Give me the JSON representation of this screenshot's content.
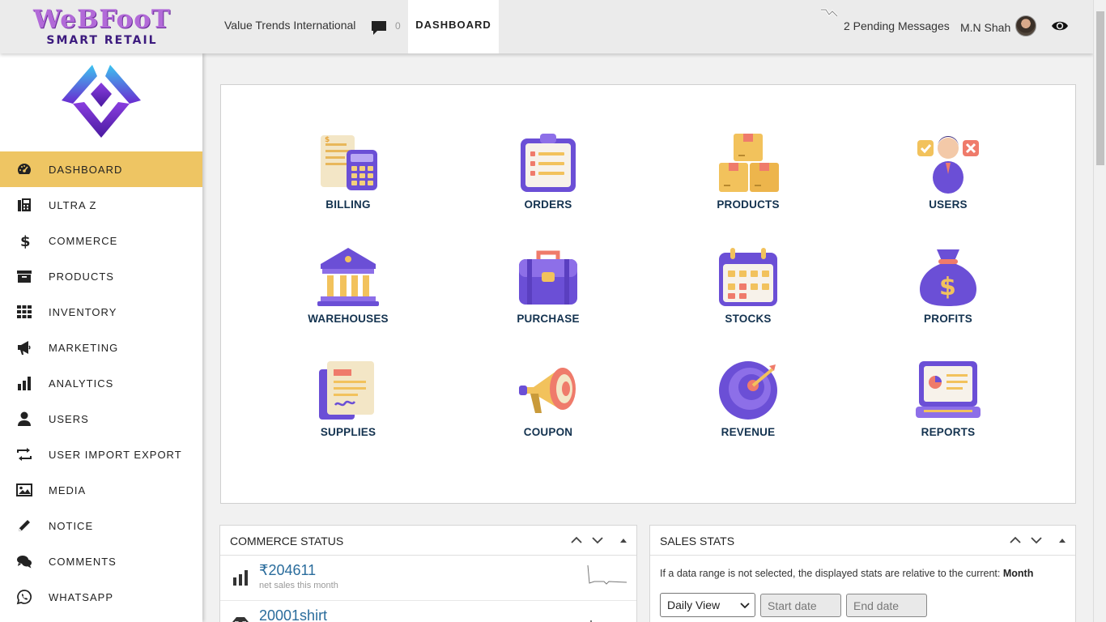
{
  "header": {
    "brand_line1": "WeBFooT",
    "brand_line2": "SMART RETAIL",
    "company": "Value Trends International",
    "message_count": "0",
    "active_tab": "DASHBOARD",
    "pending_messages": "2 Pending Messages",
    "user_name": "M.N Shah"
  },
  "sidebar": {
    "items": [
      {
        "label": "DASHBOARD",
        "icon": "dashboard-gauge-icon",
        "active": true
      },
      {
        "label": "ULTRA Z",
        "icon": "fax-icon"
      },
      {
        "label": "COMMERCE",
        "icon": "dollar-icon"
      },
      {
        "label": "PRODUCTS",
        "icon": "archive-box-icon"
      },
      {
        "label": "INVENTORY",
        "icon": "grid-icon"
      },
      {
        "label": "MARKETING",
        "icon": "megaphone-icon"
      },
      {
        "label": "ANALYTICS",
        "icon": "bar-chart-icon"
      },
      {
        "label": "USERS",
        "icon": "user-icon"
      },
      {
        "label": "USER IMPORT EXPORT",
        "icon": "swap-arrows-icon"
      },
      {
        "label": "MEDIA",
        "icon": "image-icon"
      },
      {
        "label": "NOTICE",
        "icon": "pencil-icon"
      },
      {
        "label": "COMMENTS",
        "icon": "chat-bubbles-icon"
      },
      {
        "label": "WHATSAPP",
        "icon": "whatsapp-icon"
      }
    ]
  },
  "tiles": [
    {
      "label": "BILLING",
      "icon": "billing-calculator-icon"
    },
    {
      "label": "ORDERS",
      "icon": "clipboard-list-icon"
    },
    {
      "label": "PRODUCTS",
      "icon": "stacked-boxes-icon"
    },
    {
      "label": "USERS",
      "icon": "user-check-icon"
    },
    {
      "label": "WAREHOUSES",
      "icon": "bank-building-icon"
    },
    {
      "label": "PURCHASE",
      "icon": "briefcase-icon"
    },
    {
      "label": "STOCKS",
      "icon": "calendar-icon"
    },
    {
      "label": "PROFITS",
      "icon": "money-bag-icon"
    },
    {
      "label": "SUPPLIES",
      "icon": "documents-icon"
    },
    {
      "label": "COUPON",
      "icon": "megaphone-icon"
    },
    {
      "label": "REVENUE",
      "icon": "target-icon"
    },
    {
      "label": "REPORTS",
      "icon": "laptop-chart-icon"
    }
  ],
  "commerce_status": {
    "title": "COMMERCE STATUS",
    "rows": [
      {
        "value": "₹204611",
        "sub": "net sales this month",
        "icon": "bar-chart-icon"
      },
      {
        "value": "20001shirt",
        "sub": "",
        "icon": "inbox-icon"
      }
    ]
  },
  "sales_stats": {
    "title": "SALES STATS",
    "note_prefix": "If a data range is not selected, the displayed stats are relative to the current:",
    "note_period": "Month",
    "view_select": "Daily View",
    "start_placeholder": "Start date",
    "end_placeholder": "End date"
  },
  "colors": {
    "accent": "#eec563",
    "tile_label": "#13324f",
    "stat_value": "#2a6c9c",
    "brand_purple": "#6b3fd4"
  }
}
